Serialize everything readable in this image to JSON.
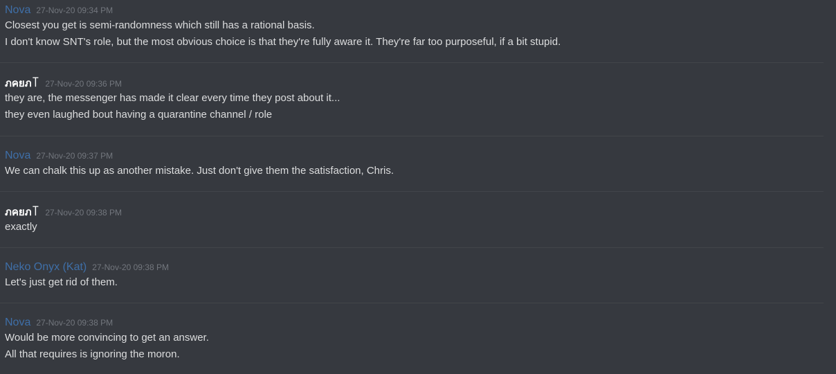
{
  "messages": [
    {
      "author": "Nova",
      "timestamp": "27-Nov-20 09:34 PM",
      "lines": [
        "Closest you get is semi-randomness which still has a rational basis.",
        "I don't know SNT's role, but the most obvious choice is that they're fully aware it. They're far too purposeful, if a bit stupid."
      ]
    },
    {
      "author": "ภคยภ꓄",
      "timestamp": "27-Nov-20 09:36 PM",
      "lines": [
        "they are, the messenger has made it clear every time they post about it...",
        "they even laughed bout having a quarantine channel / role"
      ]
    },
    {
      "author": "Nova",
      "timestamp": "27-Nov-20 09:37 PM",
      "lines": [
        "We can chalk this up as another mistake. Just don't give them the satisfaction, Chris."
      ]
    },
    {
      "author": "ภคยภ꓄",
      "timestamp": "27-Nov-20 09:38 PM",
      "lines": [
        "exactly"
      ]
    },
    {
      "author": "Neko Onyx (Kat)",
      "timestamp": "27-Nov-20 09:38 PM",
      "lines": [
        "Let's just get rid of them."
      ]
    },
    {
      "author": "Nova",
      "timestamp": "27-Nov-20 09:38 PM",
      "lines": [
        "Would be more convincing to get an answer.",
        "All that requires is ignoring the moron."
      ]
    }
  ],
  "colors": {
    "background": "#36393f",
    "author_blue": "#3f6fa8",
    "author_white": "#ffffff",
    "timestamp": "#72767d",
    "text": "#dcddde",
    "divider": "#42454a"
  }
}
